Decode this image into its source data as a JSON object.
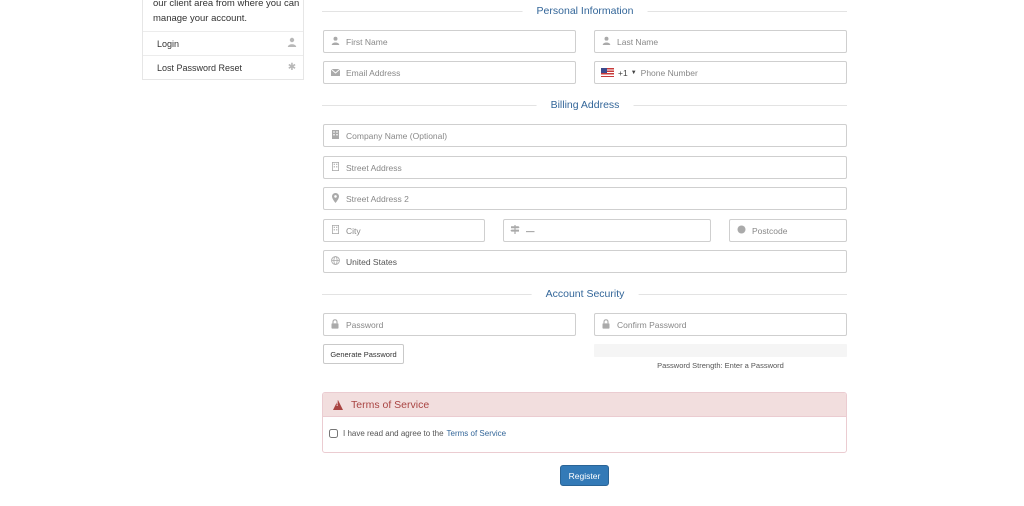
{
  "sidebar": {
    "intro": "our client area from where you can manage your account.",
    "items": [
      {
        "label": "Login",
        "icon": "user-icon"
      },
      {
        "label": "Lost Password Reset",
        "icon": "asterisk-icon"
      }
    ]
  },
  "sections": {
    "personal": "Personal Information",
    "billing": "Billing Address",
    "security": "Account Security"
  },
  "personal": {
    "first_name_placeholder": "First Name",
    "last_name_placeholder": "Last Name",
    "email_placeholder": "Email Address",
    "phone_dial_code": "+1",
    "phone_placeholder": "Phone Number"
  },
  "billing": {
    "company_placeholder": "Company Name (Optional)",
    "street_placeholder": "Street Address",
    "street2_placeholder": "Street Address 2",
    "city_placeholder": "City",
    "state_value": "—",
    "postcode_placeholder": "Postcode",
    "country_value": "United States"
  },
  "security": {
    "password_placeholder": "Password",
    "confirm_placeholder": "Confirm Password",
    "generate_label": "Generate Password",
    "strength_text": "Password Strength: Enter a Password"
  },
  "terms": {
    "title": "Terms of Service",
    "agree_text": "I have read and agree to the",
    "link_text": "Terms of Service"
  },
  "register_label": "Register",
  "colors": {
    "accent": "#337ab7",
    "section_title": "#336699",
    "danger": "#a94442",
    "danger_bg": "#f2dede"
  }
}
